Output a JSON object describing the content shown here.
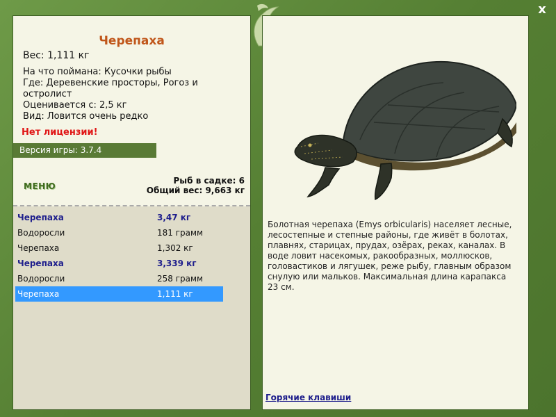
{
  "fish": {
    "title": "Черепаха",
    "weight": "Вес: 1,111 кг",
    "caught_on": "На что поймана: Кусочки рыбы",
    "where": "Где: Деревенские просторы, Рогоз и остролист",
    "value": "Оценивается с: 2,5 кг",
    "kind": "Вид: Ловится очень редко"
  },
  "license_status": "Нет лицензии!",
  "version": "Версия игры: 3.7.4",
  "menu_label": "МЕНЮ",
  "sack": {
    "count": "Рыб в садке: 6",
    "total_weight": "Общий вес: 9,663 кг"
  },
  "catch_list": [
    {
      "name": "Черепаха",
      "value": "3,47 кг",
      "style": "bold"
    },
    {
      "name": "Водоросли",
      "value": "181 грамм",
      "style": "normal"
    },
    {
      "name": "Черепаха",
      "value": "1,302 кг",
      "style": "normal"
    },
    {
      "name": "Черепаха",
      "value": "3,339 кг",
      "style": "bold"
    },
    {
      "name": "Водоросли",
      "value": "258 грамм",
      "style": "normal"
    },
    {
      "name": "Черепаха",
      "value": "1,111 кг",
      "style": "selected"
    }
  ],
  "description": "Болотная черепаха (Emys orbicularis) населяет лесные, лесостепные и степные районы, где живёт в болотах, плавнях, старицах, прудах, озёрах, реках, каналах. В воде ловит насекомых, ракообразных, моллюсков, головастиков и лягушек, реже рыбу, главным образом снулую или мальков. Максимальная длина карапакса 23 см.",
  "hotkeys_label": "Горячие клавиши",
  "close_symbol": "x",
  "colors": {
    "frame": "#5f8a3c",
    "panel": "#f5f5e6",
    "title": "#c0561a",
    "alert": "#e01616",
    "bold_row": "#1e1e8c",
    "selected_row": "#3399ff"
  }
}
